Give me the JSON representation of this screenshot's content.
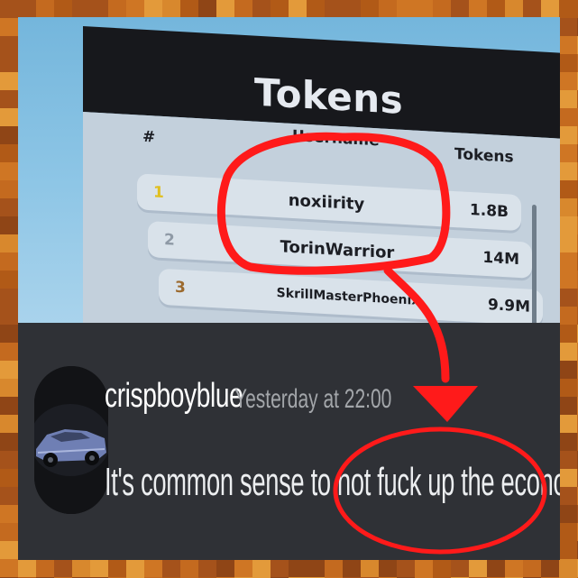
{
  "leaderboard": {
    "title": "Tokens",
    "headers": {
      "rank": "#",
      "username": "Username",
      "tokens": "Tokens"
    },
    "rows": [
      {
        "rank": "1",
        "username": "noxiirity",
        "tokens": "1.8B"
      },
      {
        "rank": "2",
        "username": "TorinWarrior",
        "tokens": "14M"
      },
      {
        "rank": "3",
        "username": "SkrillMasterPhoenix",
        "tokens": "9.9M"
      }
    ]
  },
  "message": {
    "username": "crispboyblue",
    "timestamp": "Yesterday at 22:00",
    "text": "It's common sense to not fuck up the economy.."
  },
  "colors": {
    "annotation": "#ff1a1a",
    "discord_bg": "#2f3136",
    "frame_border": "#b8651e",
    "rank_gold": "#e0bf1e",
    "rank_silver": "#8f9aa6",
    "rank_bronze": "#9c6a2e"
  }
}
